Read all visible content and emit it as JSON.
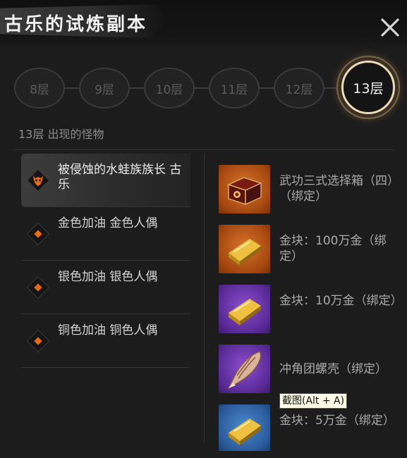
{
  "header": {
    "title": "古乐的试炼副本",
    "close_icon": "close-icon"
  },
  "floors": {
    "items": [
      "8层",
      "9层",
      "10层",
      "11层",
      "12层",
      "13层"
    ],
    "selected": "13层"
  },
  "monster_section": {
    "title": "13层 出现的怪物"
  },
  "monsters": [
    {
      "name": "被侵蚀的水蛙族族长 古乐",
      "icon": "demon-head-icon",
      "selected": true
    },
    {
      "name": "金色加油 金色人偶",
      "icon": "diamond-icon"
    },
    {
      "name": "银色加油 银色人偶",
      "icon": "diamond-icon"
    },
    {
      "name": "铜色加油 铜色人偶",
      "icon": "diamond-icon"
    }
  ],
  "rewards": [
    {
      "name": "武功三式选择箱（四）（绑定）",
      "icon": "treasure-chest-icon",
      "rarity_color": "#a64811"
    },
    {
      "name": "金块：100万金（绑定）",
      "icon": "gold-bar-icon",
      "rarity_color": "#a64811"
    },
    {
      "name": "金块：10万金（绑定）",
      "icon": "gold-bar-icon",
      "rarity_color": "#5a2b97"
    },
    {
      "name": "冲角团螺壳（绑定）",
      "icon": "conch-shell-icon",
      "rarity_color": "#5a2b97"
    },
    {
      "name": "金块：5万金（绑定）",
      "icon": "gold-bar-icon",
      "rarity_color": "#2a5a9a"
    }
  ],
  "tooltip": {
    "text": "截图(Alt + A)"
  },
  "colors": {
    "accent": "#e86a14",
    "active_ring": "#e9d9b6",
    "background": "#1c1c1c"
  }
}
